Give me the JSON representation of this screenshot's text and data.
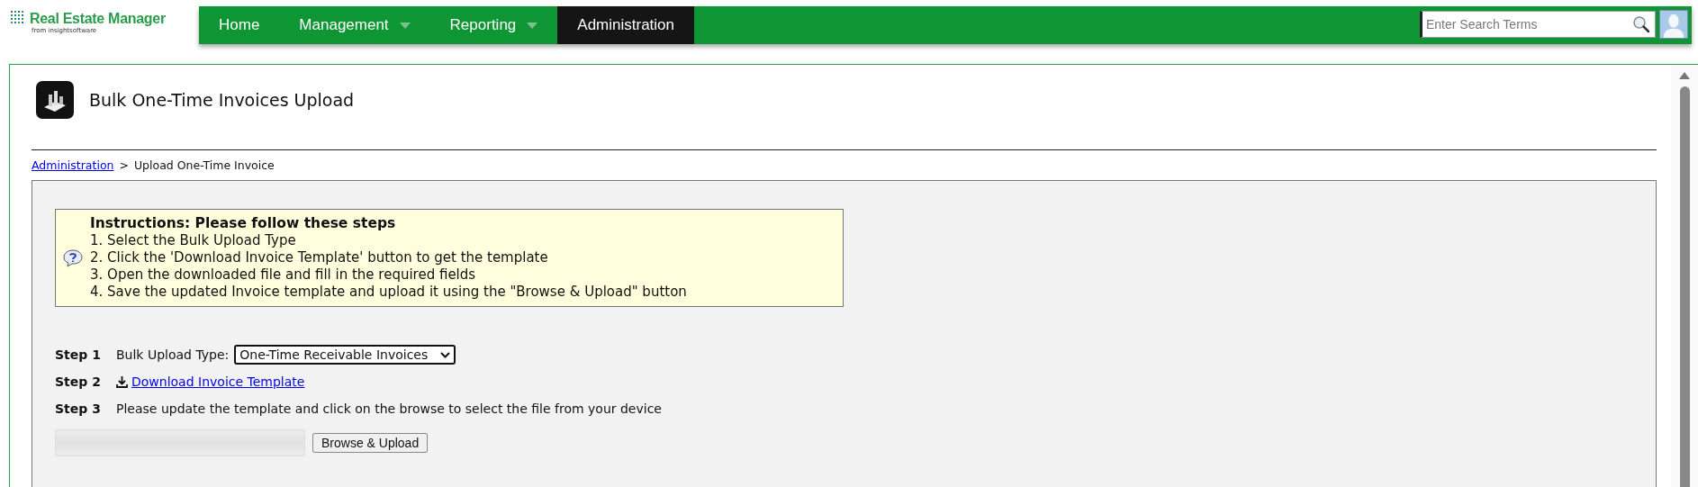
{
  "brand": {
    "name": "Real Estate Manager",
    "tagline": "from insightsoftware"
  },
  "nav": [
    {
      "label": "Home",
      "selected": false,
      "has_menu": false
    },
    {
      "label": "Management",
      "selected": false,
      "has_menu": true
    },
    {
      "label": "Reporting",
      "selected": false,
      "has_menu": true
    },
    {
      "label": "Administration",
      "selected": true,
      "has_menu": false
    }
  ],
  "search": {
    "placeholder": "Enter Search Terms"
  },
  "page": {
    "title": "Bulk One-Time Invoices Upload"
  },
  "breadcrumb": {
    "link": "Administration",
    "separator": ">",
    "current": "Upload One-Time Invoice"
  },
  "instructions": {
    "heading": "Instructions: Please follow these steps",
    "lines": [
      "1. Select the Bulk Upload Type",
      "2. Click the 'Download Invoice Template' button to get the template",
      "3. Open the downloaded file and fill in the required fields",
      "4. Save the updated Invoice template and upload it using the \"Browse & Upload\" button"
    ]
  },
  "steps": [
    {
      "label": "Step 1",
      "kind": "select",
      "field_label": "Bulk Upload Type:",
      "value": "One-Time Receivable Invoices"
    },
    {
      "label": "Step 2",
      "kind": "link",
      "text": "Download Invoice Template"
    },
    {
      "label": "Step 3",
      "kind": "text",
      "text": "Please update the template and click on the browse to select the file from your device"
    }
  ],
  "upload": {
    "button": "Browse & Upload"
  }
}
